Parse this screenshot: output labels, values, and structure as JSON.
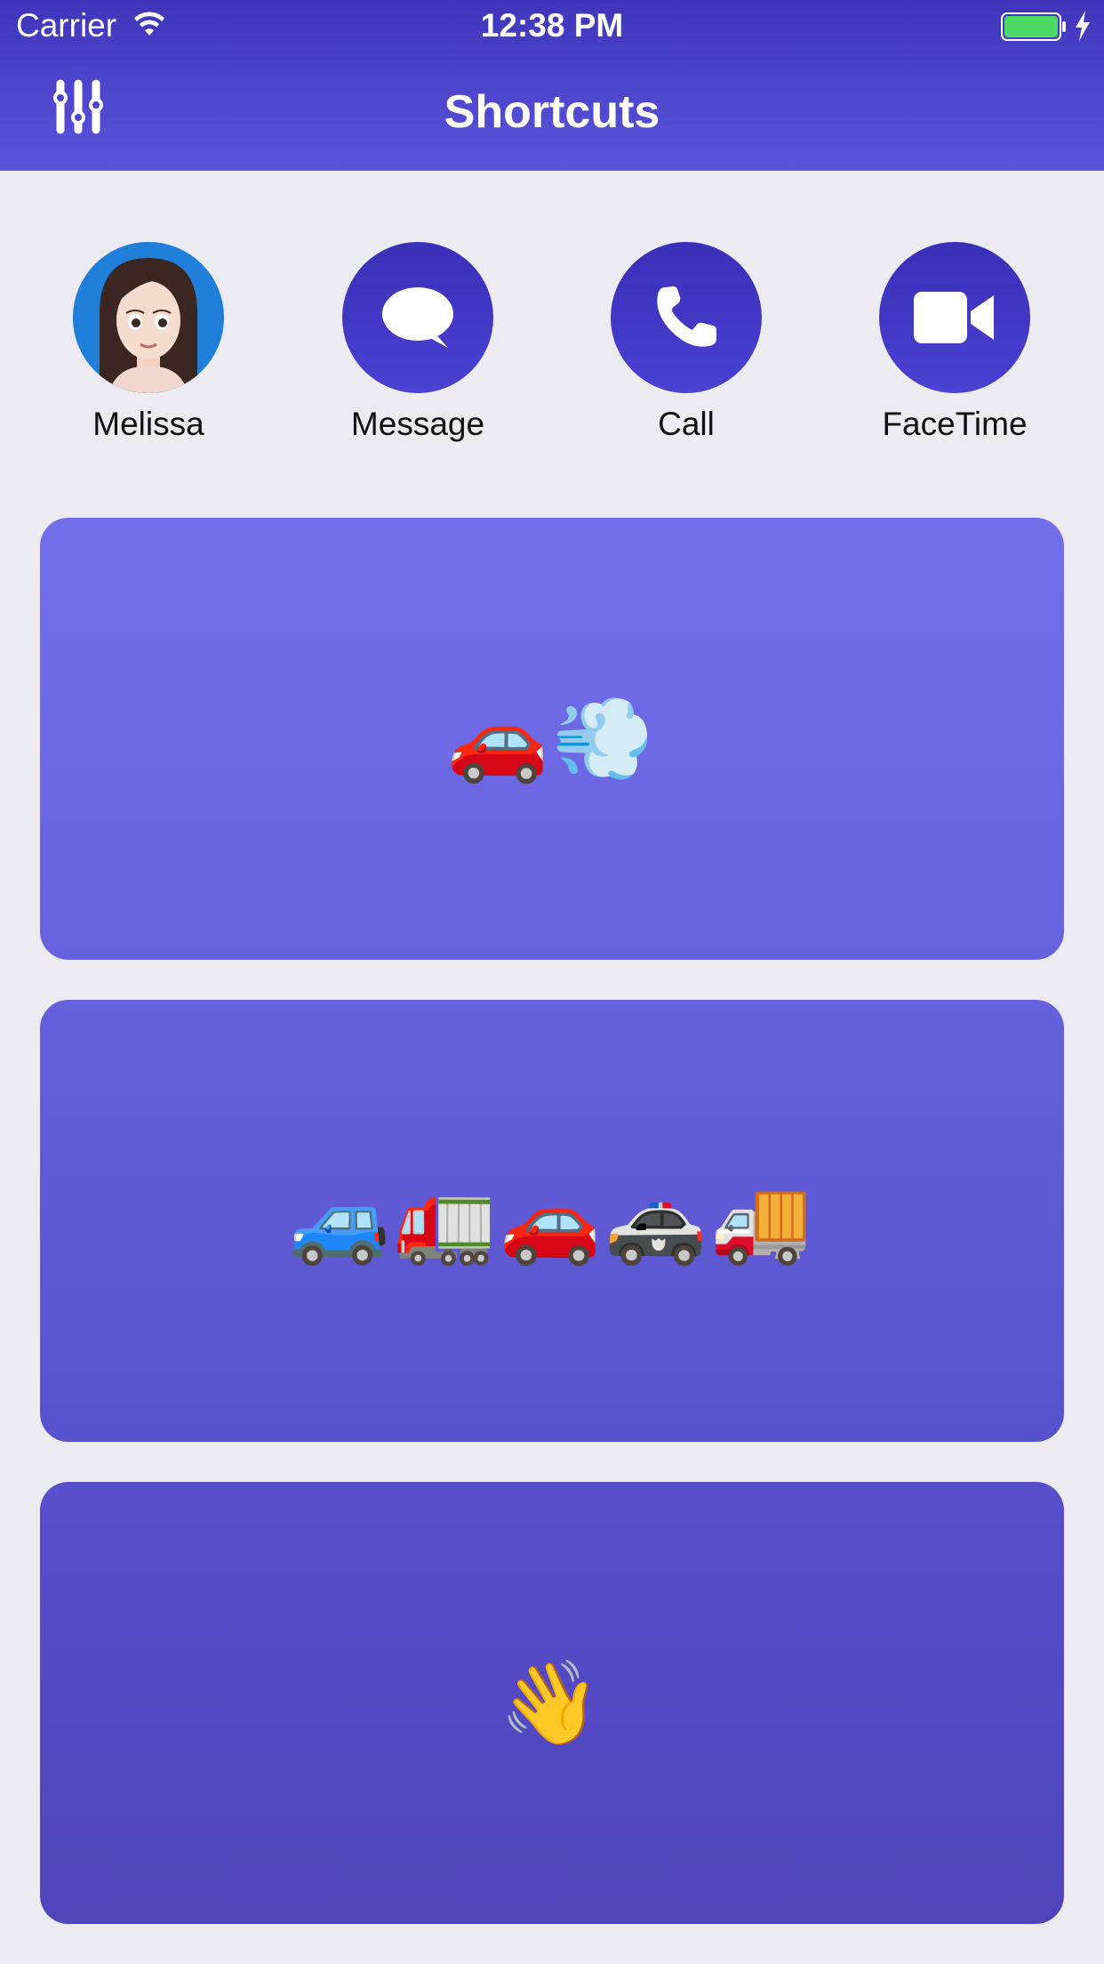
{
  "status_bar": {
    "carrier": "Carrier",
    "time": "12:38 PM",
    "battery_color": "#4cd964"
  },
  "header": {
    "title": "Shortcuts",
    "settings_icon": "sliders-icon",
    "gradient": [
      "#3f35bb",
      "#5a55dc"
    ]
  },
  "actions": [
    {
      "label": "Melissa",
      "icon": "avatar"
    },
    {
      "label": "Message",
      "icon": "message-bubble-icon"
    },
    {
      "label": "Call",
      "icon": "phone-icon"
    },
    {
      "label": "FaceTime",
      "icon": "video-camera-icon"
    }
  ],
  "cards": [
    {
      "emoji": "🚗💨"
    },
    {
      "emoji": "🚙🚛🚗🚓🚚"
    },
    {
      "emoji": "👋"
    }
  ],
  "colors": {
    "background": "#ecebf1",
    "action_circle": "#4036c4",
    "card_top": "#746fea",
    "card_bottom": "#4f44ba"
  }
}
